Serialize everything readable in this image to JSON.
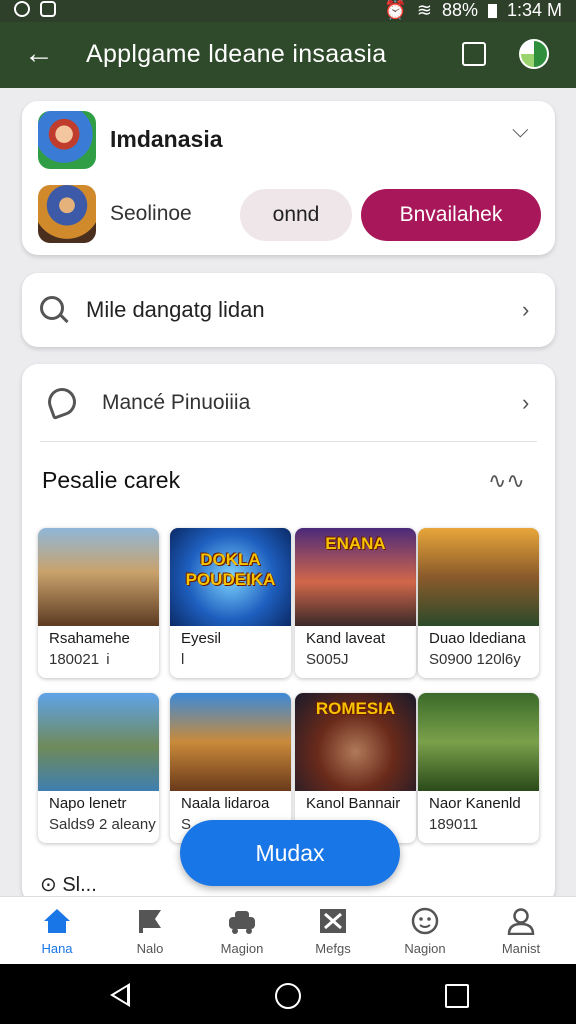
{
  "status_bar": {
    "time": "1:34 M",
    "battery": "88%"
  },
  "app_bar": {
    "back_glyph": "←",
    "title": "Applgame ldeane insaasia",
    "icons": [
      "back-arrow-icon",
      "square-icon",
      "shield-icon"
    ]
  },
  "top_card": {
    "title": "Imdanasia",
    "chevron": "⌵",
    "subtitle": "Seolinoe",
    "secondary_button": "onnd",
    "primary_button": "Bnvailahek",
    "colors": {
      "primary": "#a8175a",
      "secondary": "#efe6ea"
    }
  },
  "search_row": {
    "text": "Mile dangatg lidan",
    "chevron": "›"
  },
  "promo_card": {
    "row_label": "Mancé Pinuoiiia",
    "row_chevron": "›",
    "section_title": "Pesalie carek",
    "section_glyph": "∿∿",
    "games": [
      {
        "art_text": "",
        "name": "Rsahamehe",
        "meta": "180021  i"
      },
      {
        "art_text": "DOKLA POUDEIKA",
        "name": "Eyesil",
        "meta": "l"
      },
      {
        "art_text": "ENANA",
        "name": "Kand laveat",
        "meta": "S005J"
      },
      {
        "art_text": "",
        "name": "Duao ldediana",
        "meta": "S0900 120l6y"
      },
      {
        "art_text": "",
        "name": "Napo lenetr",
        "meta": "Salds9 2 aleany"
      },
      {
        "art_text": "",
        "name": "Naala lidaroa",
        "meta": "S"
      },
      {
        "art_text": "ROMESIA",
        "name": "Kanol Bannair",
        "meta": ""
      },
      {
        "art_text": "",
        "name": "Naor Kanenld",
        "meta": "189011"
      }
    ],
    "partial_text": "⊙ Sl..."
  },
  "fab": {
    "label": "Mudax",
    "color": "#1976e6"
  },
  "bottom_nav": [
    {
      "label": "Hana",
      "icon": "home-icon",
      "active": true
    },
    {
      "label": "Nalo",
      "icon": "flag-icon",
      "active": false
    },
    {
      "label": "Magion",
      "icon": "car-icon",
      "active": false
    },
    {
      "label": "Mefgs",
      "icon": "mail-x-icon",
      "active": false
    },
    {
      "label": "Nagion",
      "icon": "smiley-icon",
      "active": false
    },
    {
      "label": "Manist",
      "icon": "user-icon",
      "active": false
    }
  ]
}
